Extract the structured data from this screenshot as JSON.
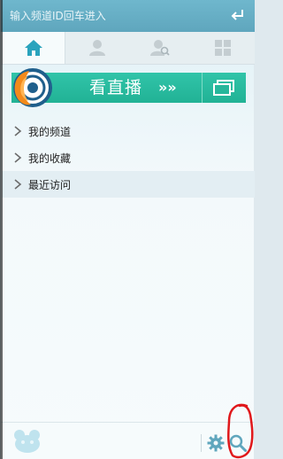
{
  "search": {
    "placeholder": "输入频道ID回车进入"
  },
  "tabs": [
    {
      "icon": "home-icon",
      "active": true
    },
    {
      "icon": "user-icon",
      "active": false
    },
    {
      "icon": "user-search-icon",
      "active": false
    },
    {
      "icon": "apps-grid-icon",
      "active": false
    }
  ],
  "banner": {
    "label": "看直播",
    "arrows": "»»",
    "color": "#26b79b"
  },
  "list": {
    "items": [
      {
        "label": "我的频道"
      },
      {
        "label": "我的收藏"
      },
      {
        "label": "最近访问"
      }
    ]
  },
  "colors": {
    "accent": "#26b79b",
    "topbar": "#66afc6",
    "scribble": "#e0181b"
  },
  "icons": [
    "enter-icon",
    "window-icon",
    "gear-icon",
    "search-icon",
    "mascot-icon",
    "yy-logo-icon"
  ]
}
